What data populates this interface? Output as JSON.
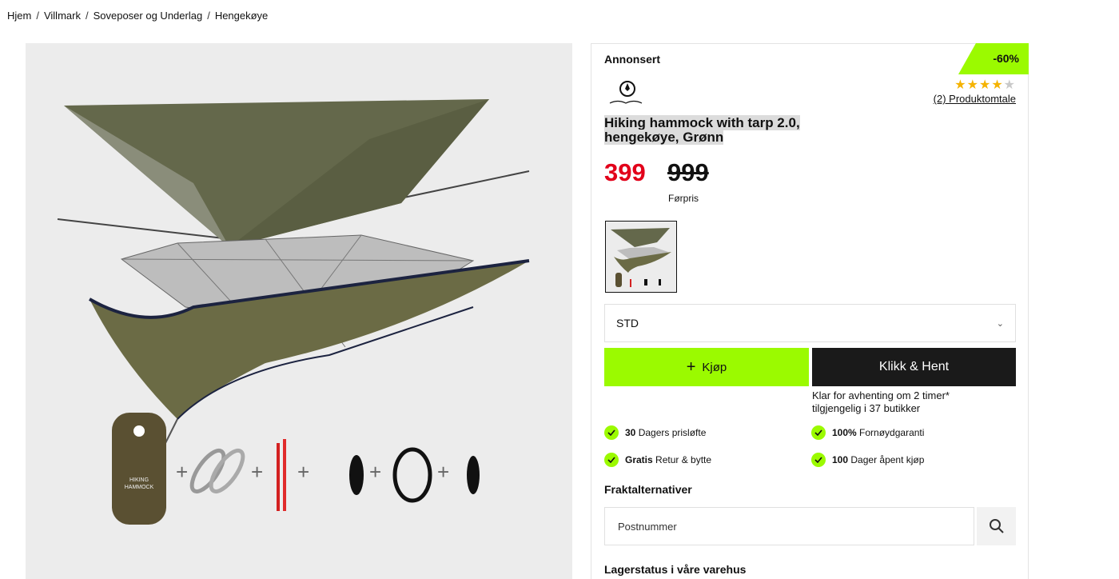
{
  "breadcrumb": [
    {
      "label": "Hjem"
    },
    {
      "label": "Villmark"
    },
    {
      "label": "Soveposer og Underlag"
    },
    {
      "label": "Hengekøye"
    }
  ],
  "product": {
    "sponsored_label": "Annonsert",
    "discount_badge": "-60%",
    "rating": 4.5,
    "stars": "★★★★",
    "stars_half": "★",
    "review_link": "(2) Produktomtale",
    "title_line1": "Hiking hammock with tarp 2.0,",
    "title_line2": "hengekøye, Grønn",
    "price_now": "399",
    "price_old": "999",
    "price_old_label": "Førpris",
    "variant_selected": "STD",
    "buy_label": "Kjøp",
    "click_collect_label": "Klikk & Hent",
    "pickup_line1": "Klar for avhenting om 2 timer*",
    "pickup_line2": "tilgjengelig i 37 butikker"
  },
  "usps": [
    {
      "bold": "30",
      "text": "Dagers prisløfte"
    },
    {
      "bold": "100%",
      "text": "Fornøydgaranti"
    },
    {
      "bold": "Gratis",
      "text": "Retur & bytte"
    },
    {
      "bold": "100",
      "text": "Dager åpent kjøp"
    }
  ],
  "shipping": {
    "heading": "Fraktalternativer",
    "zip_placeholder": "Postnummer"
  },
  "stock": {
    "heading": "Lagerstatus i våre varehus"
  },
  "colors": {
    "accent_green": "#9bfa00",
    "sale_red": "#e2001a",
    "dark": "#1a1a1a",
    "star": "#f5b301"
  },
  "icons": [
    "search-icon",
    "check-icon",
    "chevron-down-icon",
    "plus-icon",
    "brand-logo"
  ]
}
